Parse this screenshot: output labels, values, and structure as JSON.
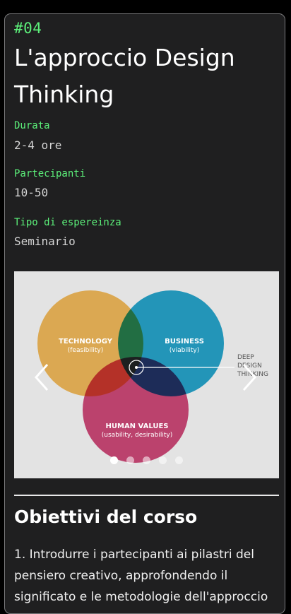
{
  "course": {
    "number": "#04",
    "title": "L'approccio Design Thinking"
  },
  "info": {
    "duration_label": "Durata",
    "duration_value": "2-4 ore",
    "participants_label": "Partecipanti",
    "participants_value": "10-50",
    "type_label": "Tipo di espereinza",
    "type_value": "Seminario"
  },
  "carousel": {
    "slide_count": 5,
    "active_index": 0,
    "prev_icon": "chevron-left-icon",
    "next_icon": "chevron-right-icon",
    "diagram": {
      "technology_title": "TECHNOLOGY",
      "technology_sub": "(feasibility)",
      "business_title": "BUSINESS",
      "business_sub": "(viability)",
      "human_title": "HUMAN VALUES",
      "human_sub": "(usability, desirability)",
      "center_line1": "DEEP",
      "center_line2": "DESIGN",
      "center_line3": "THINKING"
    }
  },
  "objectives": {
    "title": "Obiettivi del corso",
    "body": "1. Introdurre i partecipanti ai pilastri del pensiero creativo, approfondendo il significato e le metodologie dell'approccio"
  },
  "colors": {
    "accent": "#5cf07a",
    "card_bg": "#1f1f20",
    "technology": "#dba852",
    "business": "#27a7cf",
    "human": "#d24a7a"
  }
}
